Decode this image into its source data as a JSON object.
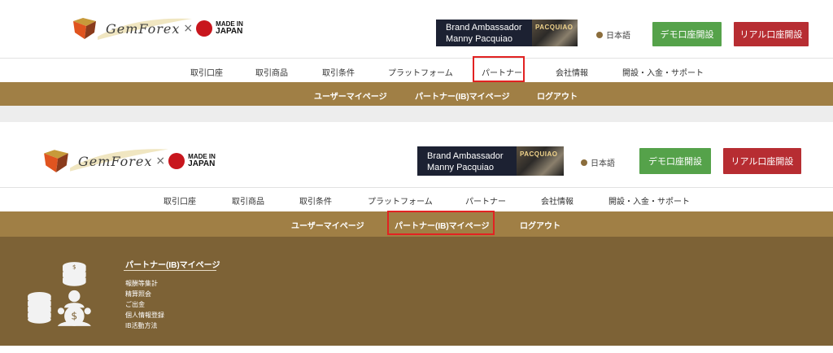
{
  "brand": {
    "name": "GemForex",
    "times": "×",
    "made_in": "MADE IN",
    "japan": "JAPAN"
  },
  "ambassador": {
    "line1": "Brand Ambassador",
    "line2": "Manny Pacquiao",
    "photo_text": "PACQUIAO"
  },
  "language": "日本語",
  "buttons": {
    "demo": "デモ口座開設",
    "real": "リアル口座開設"
  },
  "nav": {
    "items": [
      "取引口座",
      "取引商品",
      "取引条件",
      "プラットフォーム",
      "パートナー",
      "会社情報",
      "開設・入金・サポート"
    ]
  },
  "subnav": {
    "items": [
      "ユーザーマイページ",
      "パートナー(IB)マイページ",
      "ログアウト"
    ]
  },
  "dropdown": {
    "title": "パートナー(IB)マイページ",
    "links": [
      "報酬等集計",
      "精算照会",
      "ご出金",
      "個人情報登録",
      "IB活動方法"
    ]
  },
  "colors": {
    "subnav_bg": "#a07f45",
    "panel_bg": "#7d6236",
    "demo": "#55a24a",
    "real": "#b72d32",
    "highlight": "#e22222"
  }
}
